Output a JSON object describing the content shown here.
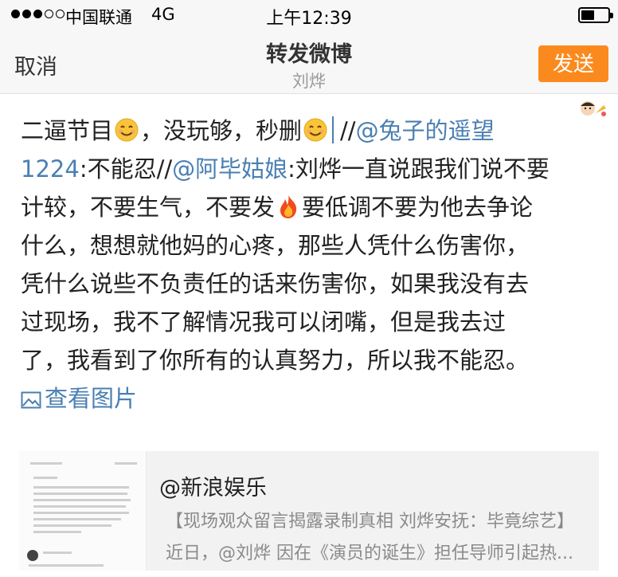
{
  "status_bar": {
    "carrier": "中国联通",
    "network": "4G",
    "time": "上午12:39",
    "signal_bars_filled": 3,
    "signal_bars_total": 5
  },
  "nav": {
    "cancel_label": "取消",
    "title": "转发微博",
    "subtitle": "刘烨",
    "send_label": "发送",
    "send_color": "#fb8a1e"
  },
  "compose": {
    "lines": [
      [
        {
          "t": "二逼节目"
        },
        {
          "e": "smile-emoji"
        },
        {
          "t": "，没玩够，秒删"
        },
        {
          "e": "smile-emoji"
        },
        {
          "c": "text-cursor"
        },
        {
          "t": "//"
        },
        {
          "t": "@兔子的遥望",
          "m": true
        }
      ],
      [
        {
          "t": "1224",
          "m": true
        },
        {
          "t": ":不能忍//"
        },
        {
          "t": "@阿毕姑娘",
          "m": true
        },
        {
          "t": ":刘烨一直说跟我们说不要"
        }
      ],
      [
        {
          "t": "计较，不要生气，不要发"
        },
        {
          "e": "fire-emoji"
        },
        {
          "t": "要低调不要为他去争论"
        }
      ],
      [
        {
          "t": "什么，想想就他妈的心疼，那些人凭什么伤害你，"
        }
      ],
      [
        {
          "t": "凭什么说些不负责任的话来伤害你，如果我没有去"
        }
      ],
      [
        {
          "t": "过现场，我不了解情况我可以闭嘴，但是我去过"
        }
      ],
      [
        {
          "t": "了，我看到了你所有的认真努力，所以我不能忍。"
        }
      ]
    ],
    "view_pictures_label": "查看图片",
    "mention_color": "#4a7fb2"
  },
  "quoted_card": {
    "name": "@新浪娱乐",
    "title": "【现场观众留言揭露录制真相 刘烨安抚：毕竟综艺】",
    "summary": "近日，@刘烨 因在《演员的诞生》担任导师引起热..."
  }
}
